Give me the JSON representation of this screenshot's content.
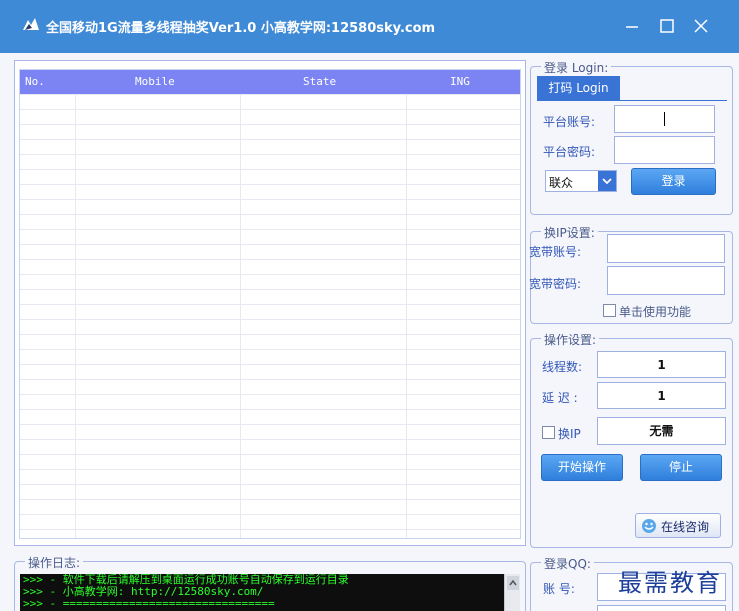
{
  "window": {
    "title": "全国移动1G流量多线程抽奖Ver1.0 小高教学网:12580sky.com",
    "controls": [
      "minimize",
      "maximize",
      "close"
    ]
  },
  "list": {
    "columns": [
      "No.",
      "Mobile",
      "State",
      "ING"
    ],
    "rows": []
  },
  "login": {
    "group_title": "登录 Login:",
    "tab_label": "打码 Login",
    "account_label": "平台账号:",
    "account_value": "",
    "password_label": "平台密码:",
    "password_value": "",
    "carrier_selected": "联众",
    "login_button": "登录"
  },
  "ip_settings": {
    "group_title": "换IP设置:",
    "account_label": "宽带账号:",
    "password_label": "宽带密码:",
    "single_click_label": "单击使用功能",
    "single_click_checked": false
  },
  "operation": {
    "group_title": "操作设置:",
    "threads_label": "线程数:",
    "threads_value": "1",
    "delay_label": "延 迟 :",
    "delay_value": "1",
    "change_ip_label": "换IP",
    "change_ip_checked": false,
    "change_ip_value": "无需",
    "start_button": "开始操作",
    "stop_button": "停止",
    "consult_button": "在线咨询"
  },
  "log": {
    "group_title": "操作日志:",
    "lines": [
      ">>> - 软件下载后请解压到桌面运行成功账号自动保存到运行目录",
      ">>> - 小高教学网: http://12580sky.com/",
      ">>> - ================================"
    ]
  },
  "qq_login": {
    "group_title": "登录QQ:",
    "account_label": "账 号:"
  },
  "watermark": "最需教育",
  "colors": {
    "titlebar": "#3f8ad6",
    "list_header": "#7b84f2",
    "button": "#2f7fdc",
    "log_bg": "#0e0e0e",
    "log_text": "#2bff2b"
  }
}
